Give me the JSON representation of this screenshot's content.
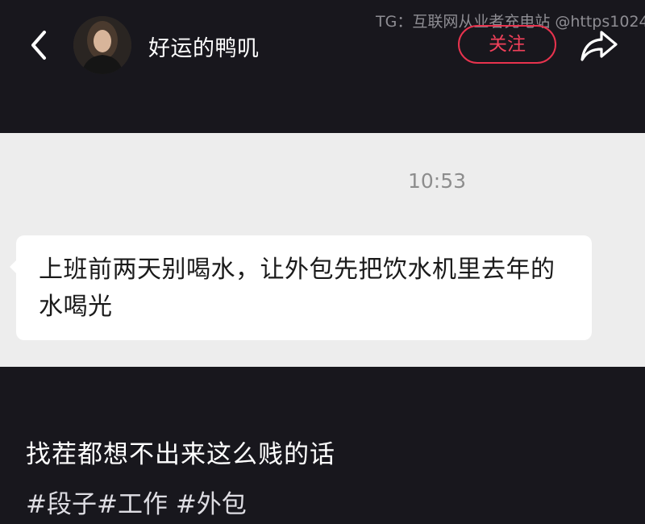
{
  "header": {
    "username": "好运的鸭叽",
    "follow_label": "关注",
    "watermark": "TG：互联网从业者充电站 @https1024"
  },
  "chat": {
    "time": "10:53",
    "message": "上班前两天别喝水，让外包先把饮水机里去年的水喝光"
  },
  "post": {
    "caption": "找茬都想不出来这么贱的话",
    "tags": [
      "#段子",
      "#工作",
      " #外包"
    ]
  },
  "colors": {
    "background": "#18171d",
    "accent": "#e8334e",
    "chat_background": "#ededed",
    "bubble": "#ffffff"
  },
  "icons": {
    "back": "chevron-left-icon",
    "share": "share-arrow-icon"
  }
}
